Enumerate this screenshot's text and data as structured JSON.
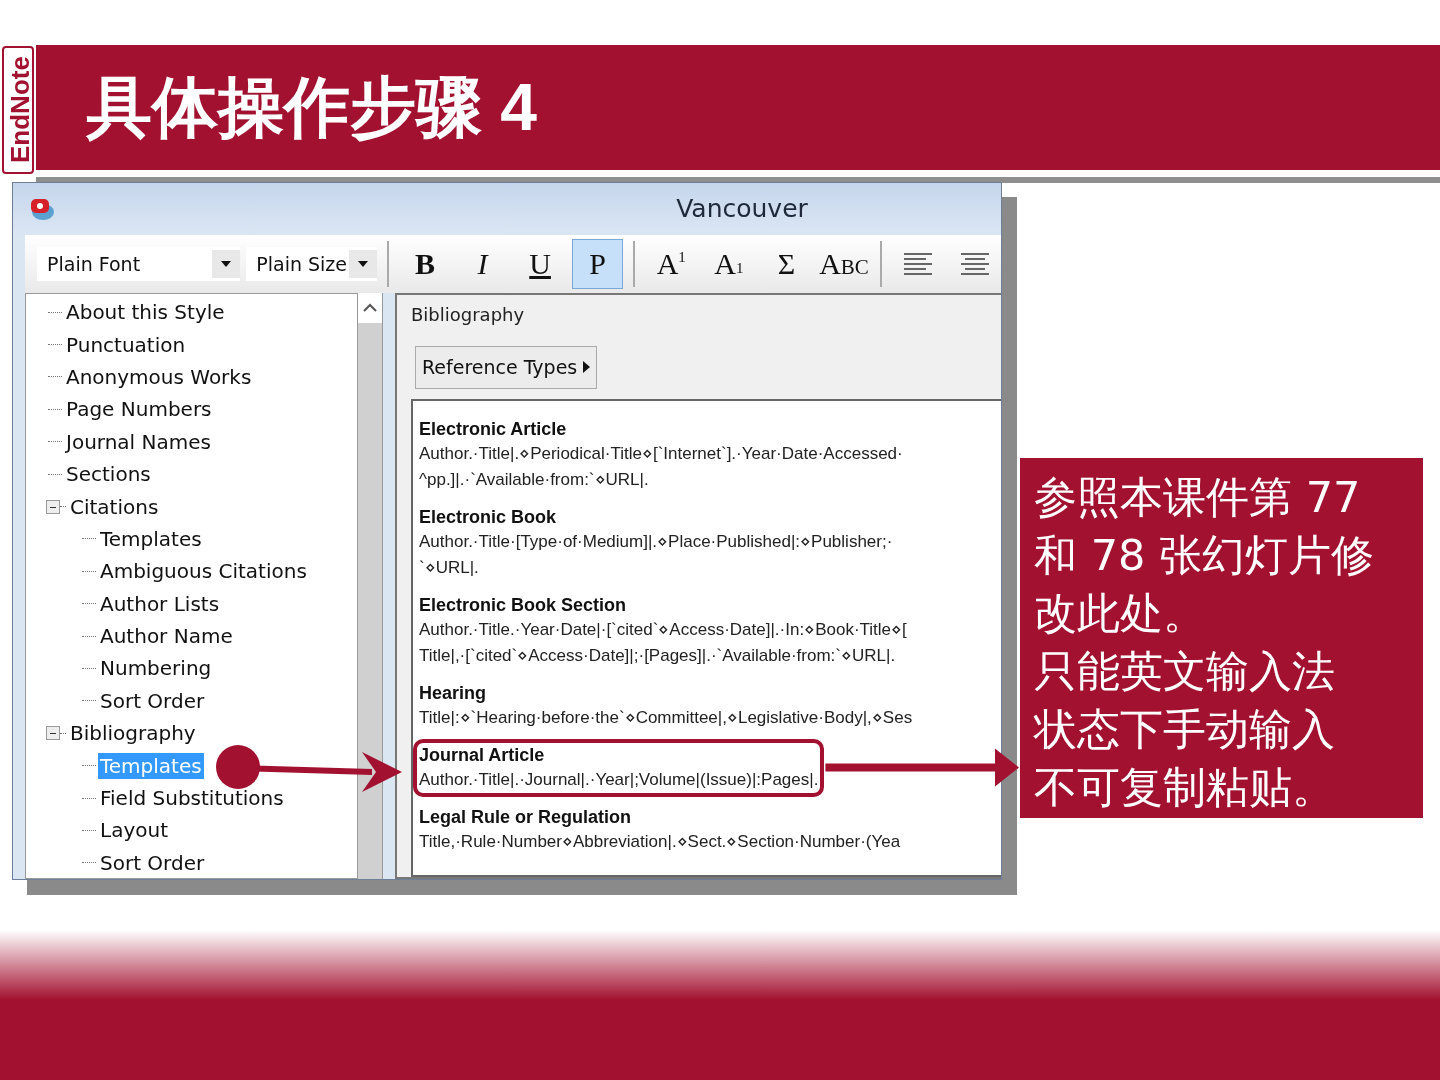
{
  "slide": {
    "logo": "EndNote",
    "title": "具体操作步骤 4",
    "callout": [
      "参照本课件第 77",
      "和 78 张幻灯片修",
      "改此处。",
      "只能英文输入法",
      "状态下手动输入",
      "不可复制粘贴。"
    ]
  },
  "window": {
    "title": "Vancouver",
    "toolbar": {
      "font": "Plain Font",
      "size": "Plain Size",
      "buttons": [
        {
          "kind": "bold",
          "label": "B",
          "selected": false
        },
        {
          "kind": "italic",
          "label": "I",
          "selected": false
        },
        {
          "kind": "underline",
          "label": "U",
          "selected": false
        },
        {
          "kind": "plain",
          "label": "P",
          "selected": true
        },
        {
          "kind": "superscript",
          "label": "A$^{1}$",
          "selected": false
        },
        {
          "kind": "subscript",
          "label": "A$_{1}$",
          "selected": false
        },
        {
          "kind": "symbol",
          "label": "Σ",
          "selected": false
        },
        {
          "kind": "smallcaps",
          "label": "Abc",
          "selected": false
        },
        {
          "kind": "align-left",
          "selected": false
        },
        {
          "kind": "align-center",
          "selected": false
        }
      ]
    },
    "tree": [
      {
        "label": "About this Style",
        "selected": false
      },
      {
        "label": "Punctuation",
        "selected": false
      },
      {
        "label": "Anonymous Works",
        "selected": false
      },
      {
        "label": "Page Numbers",
        "selected": false
      },
      {
        "label": "Journal Names",
        "selected": false
      },
      {
        "label": "Sections",
        "selected": false
      },
      {
        "label": "Citations",
        "selected": false,
        "expanded": true,
        "children": [
          {
            "label": "Templates",
            "selected": false
          },
          {
            "label": "Ambiguous Citations",
            "selected": false
          },
          {
            "label": "Author Lists",
            "selected": false
          },
          {
            "label": "Author Name",
            "selected": false
          },
          {
            "label": "Numbering",
            "selected": false
          },
          {
            "label": "Sort Order",
            "selected": false
          }
        ]
      },
      {
        "label": "Bibliography",
        "selected": false,
        "expanded": true,
        "children": [
          {
            "label": "Templates",
            "selected": true
          },
          {
            "label": "Field Substitutions",
            "selected": false
          },
          {
            "label": "Layout",
            "selected": false
          },
          {
            "label": "Sort Order",
            "selected": false
          }
        ]
      }
    ],
    "panel": {
      "title": "Bibliography",
      "menu_button": "Reference Types",
      "templates": [
        {
          "name": "Electronic Article",
          "lines": [
            "Author.·Title|.⋄Periodical·Title⋄[`Internet`].·Year·Date·Accessed·",
            "^pp.]|.·`Available·from:`⋄URL|."
          ],
          "highlighted": false
        },
        {
          "name": "Electronic Book",
          "lines": [
            "Author.·Title·[Type·of·Medium]|.⋄Place·Published|:⋄Publisher;·",
            "`⋄URL|."
          ],
          "highlighted": false
        },
        {
          "name": "Electronic Book Section",
          "lines": [
            "Author.·Title.·Year·Date|·[`cited`⋄Access·Date]|.·In:⋄Book·Title⋄[",
            "Title|,·[`cited`⋄Access·Date]|;·[Pages]|.·`Available·from:`⋄URL|."
          ],
          "highlighted": false
        },
        {
          "name": "Hearing",
          "lines": [
            "Title|:⋄`Hearing·before·the`⋄Committee|,⋄Legislative·Body|,⋄Ses"
          ],
          "highlighted": false
        },
        {
          "name": "Journal Article",
          "lines": [
            "Author.·Title|.·Journal|.·Year|;Volume|(Issue)|:Pages|."
          ],
          "highlighted": true
        },
        {
          "name": "Legal Rule or Regulation",
          "lines": [
            "Title,·Rule·Number⋄Abbreviation|.⋄Sect.⋄Section·Number·(Yea"
          ],
          "highlighted": false
        }
      ]
    }
  }
}
